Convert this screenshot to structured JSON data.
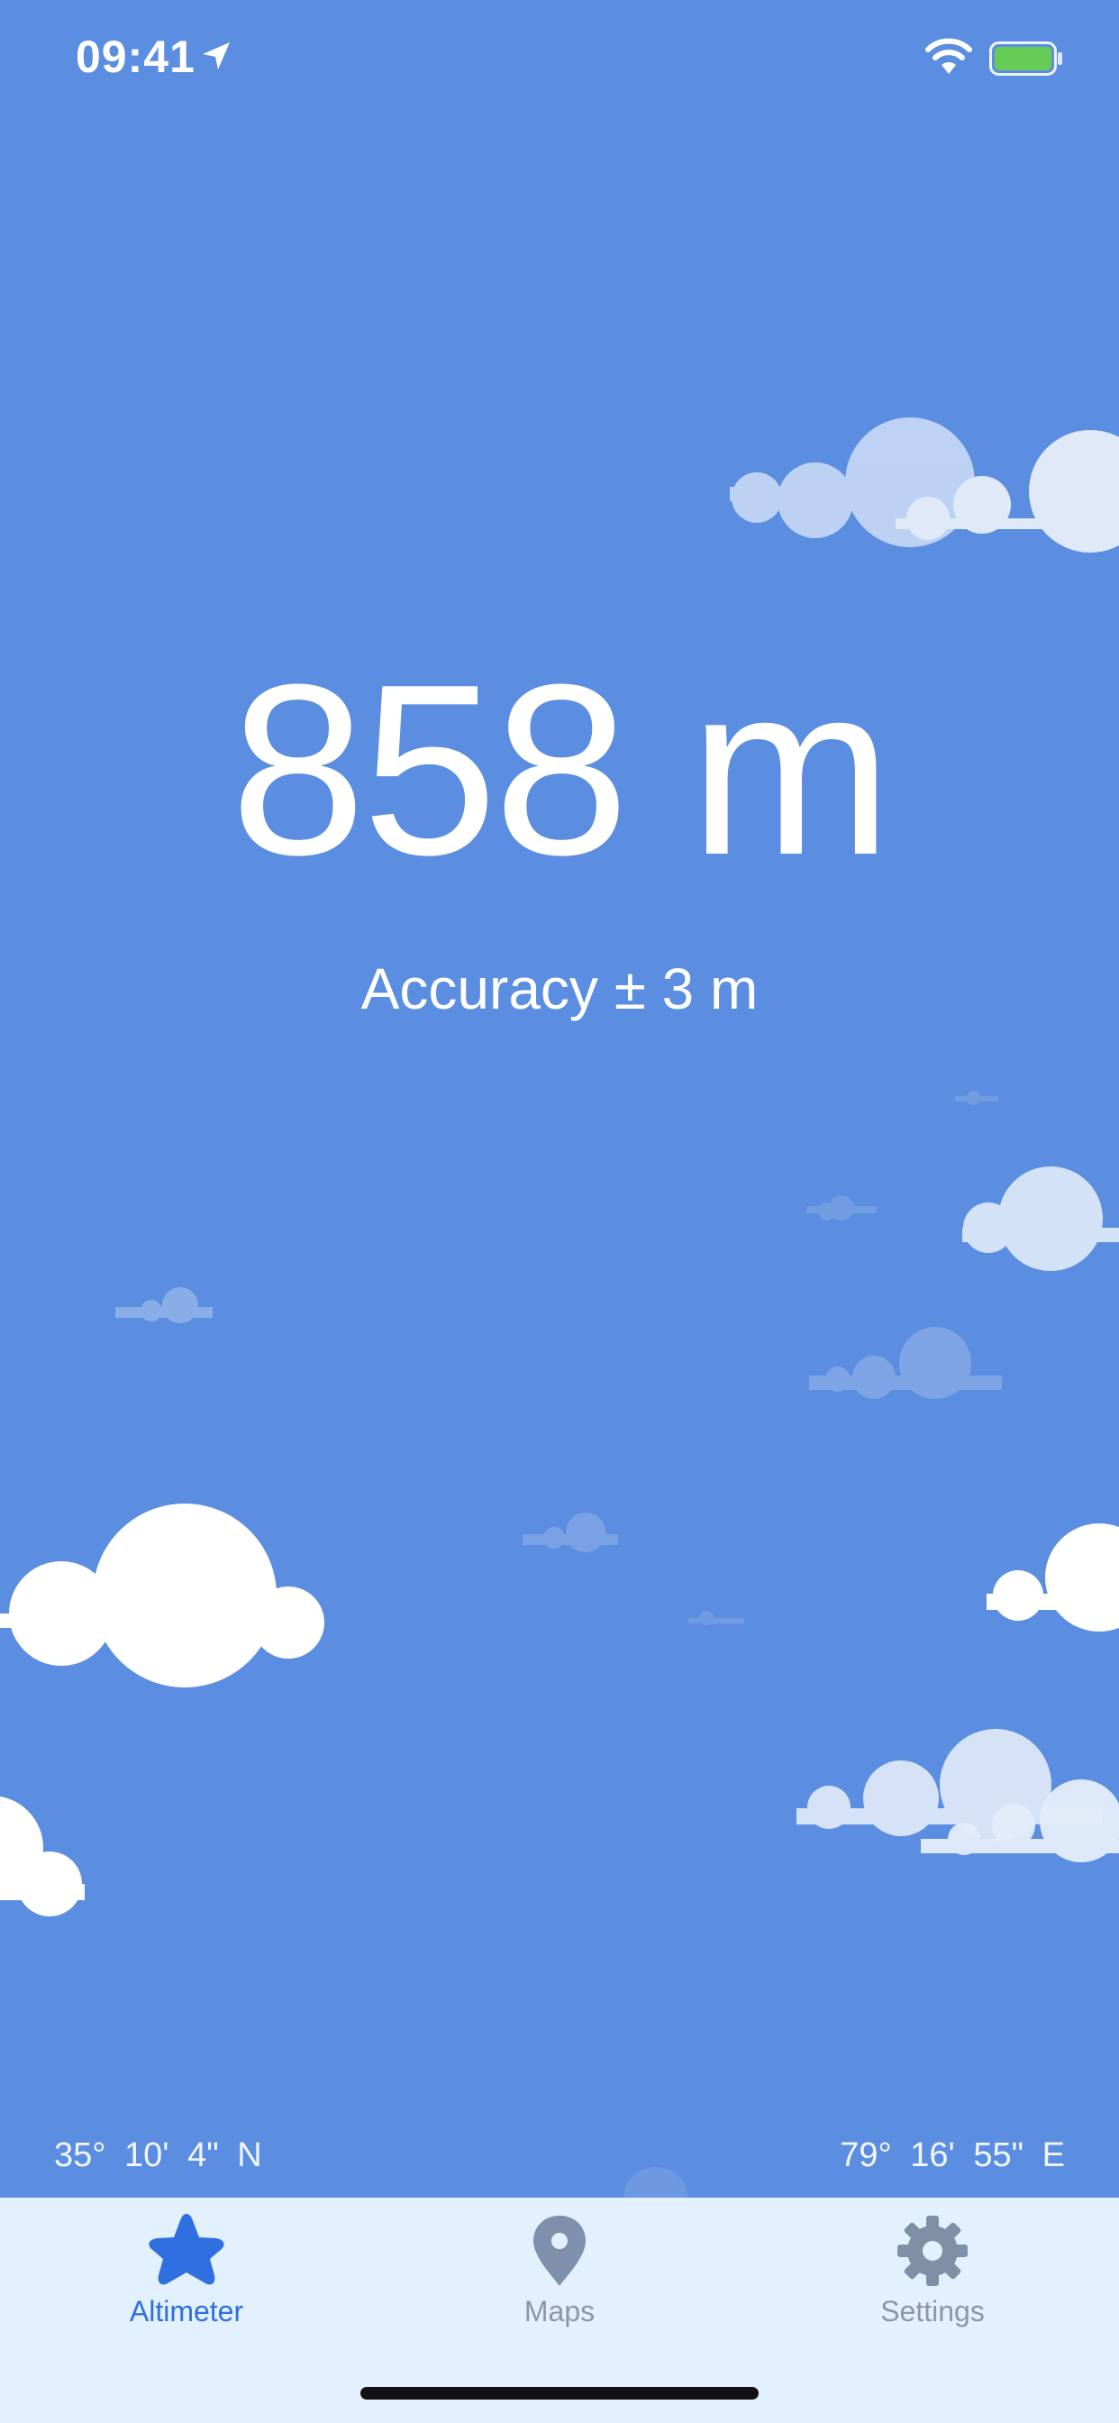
{
  "status_bar": {
    "time": "09:41",
    "icons": [
      "location-arrow-icon",
      "wifi-icon",
      "battery-icon"
    ],
    "battery_color": "#66cc55"
  },
  "main": {
    "altitude": "858 m",
    "accuracy": "Accuracy ± 3 m"
  },
  "coordinates": {
    "latitude": "35°  10'  4\" N",
    "longitude": "79°  16'  55\" E"
  },
  "tab_bar": {
    "tabs": [
      {
        "label": "Altimeter",
        "icon": "star-icon",
        "active": true
      },
      {
        "label": "Maps",
        "icon": "map-pin-icon",
        "active": false
      },
      {
        "label": "Settings",
        "icon": "gear-icon",
        "active": false
      }
    ]
  },
  "colors": {
    "sky": "#5b8ee0",
    "tab_bar_bg": "#e2f1fd",
    "active_tab": "#2f6fdf",
    "inactive_tab": "#8f96a3"
  }
}
